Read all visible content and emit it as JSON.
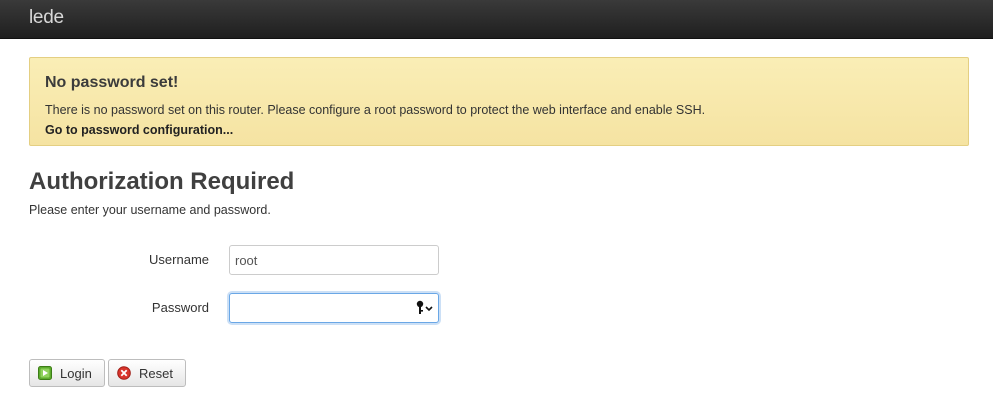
{
  "header": {
    "brand": "lede"
  },
  "alert": {
    "title": "No password set!",
    "message": "There is no password set on this router. Please configure a root password to protect the web interface and enable SSH.",
    "link_label": "Go to password configuration..."
  },
  "main": {
    "title": "Authorization Required",
    "description": "Please enter your username and password."
  },
  "form": {
    "username_label": "Username",
    "username_value": "root",
    "password_label": "Password",
    "password_value": ""
  },
  "buttons": {
    "login_label": "Login",
    "login_icon": "apply-icon",
    "reset_label": "Reset",
    "reset_icon": "reset-icon"
  },
  "colors": {
    "header_bg": "#262626",
    "alert_bg": "#f8e8a8",
    "focus_border": "#6aa7e6"
  }
}
